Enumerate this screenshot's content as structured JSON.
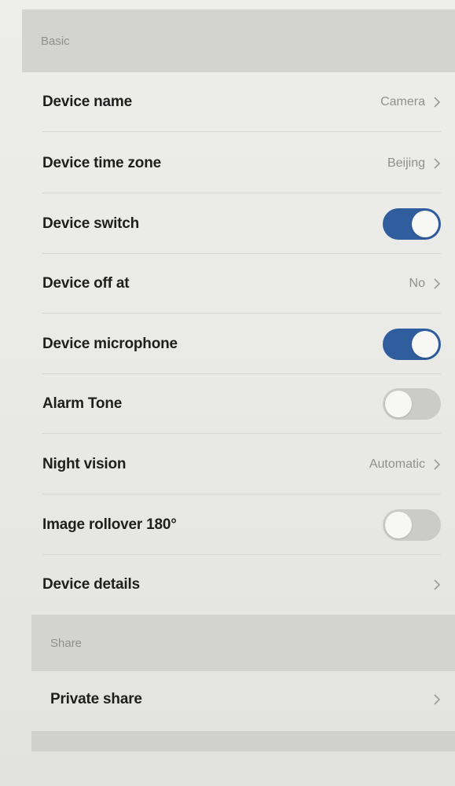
{
  "sections": {
    "basic": "Basic",
    "share": "Share"
  },
  "rows": {
    "device_name": {
      "label": "Device name",
      "value": "Camera"
    },
    "device_time_zone": {
      "label": "Device time zone",
      "value": "Beijing"
    },
    "device_switch": {
      "label": "Device switch",
      "state": "on"
    },
    "device_off_at": {
      "label": "Device off at",
      "value": "No"
    },
    "device_microphone": {
      "label": "Device microphone",
      "state": "on"
    },
    "alarm_tone": {
      "label": "Alarm Tone",
      "state": "off"
    },
    "night_vision": {
      "label": "Night vision",
      "value": "Automatic"
    },
    "image_rollover": {
      "label": "Image rollover 180°",
      "state": "off"
    },
    "device_details": {
      "label": "Device details"
    },
    "private_share": {
      "label": "Private share"
    }
  },
  "colors": {
    "toggle_on": "#2f5d9e",
    "toggle_off": "#cbccc9",
    "section_bg": "#d3d4d2"
  },
  "icons": {
    "chevron": "chevron-right-icon"
  }
}
